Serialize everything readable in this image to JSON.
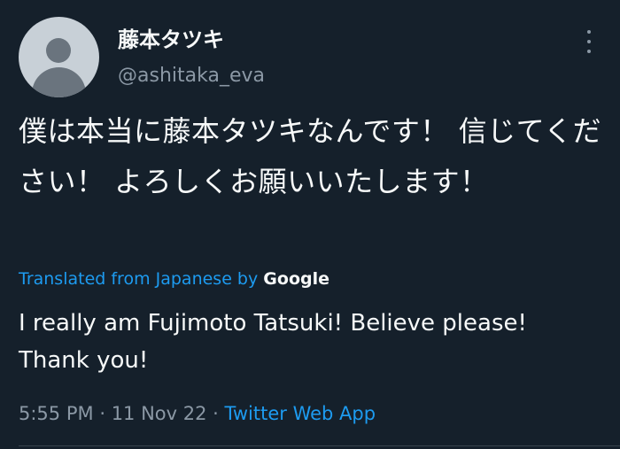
{
  "tweet": {
    "display_name": "藤本タツキ",
    "handle": "@ashitaka_eva",
    "text": "僕は本当に藤本タツキなんです！ 信じてください！ よろしくお願いいたします！",
    "translated_label": "Translated from Japanese by",
    "translation_provider": "Google",
    "translation": "I really am Fujimoto Tatsuki! Believe please! Thank you!",
    "time": "5:55 PM",
    "date": "11 Nov 22",
    "separator": "·",
    "source": "Twitter Web App"
  },
  "icons": {
    "avatar": "default-avatar-icon",
    "more": "more-vertical-icon"
  },
  "colors": {
    "background": "#15202b",
    "text": "#f7f9f9",
    "secondary": "#8b98a5",
    "accent": "#1d9bf0"
  }
}
